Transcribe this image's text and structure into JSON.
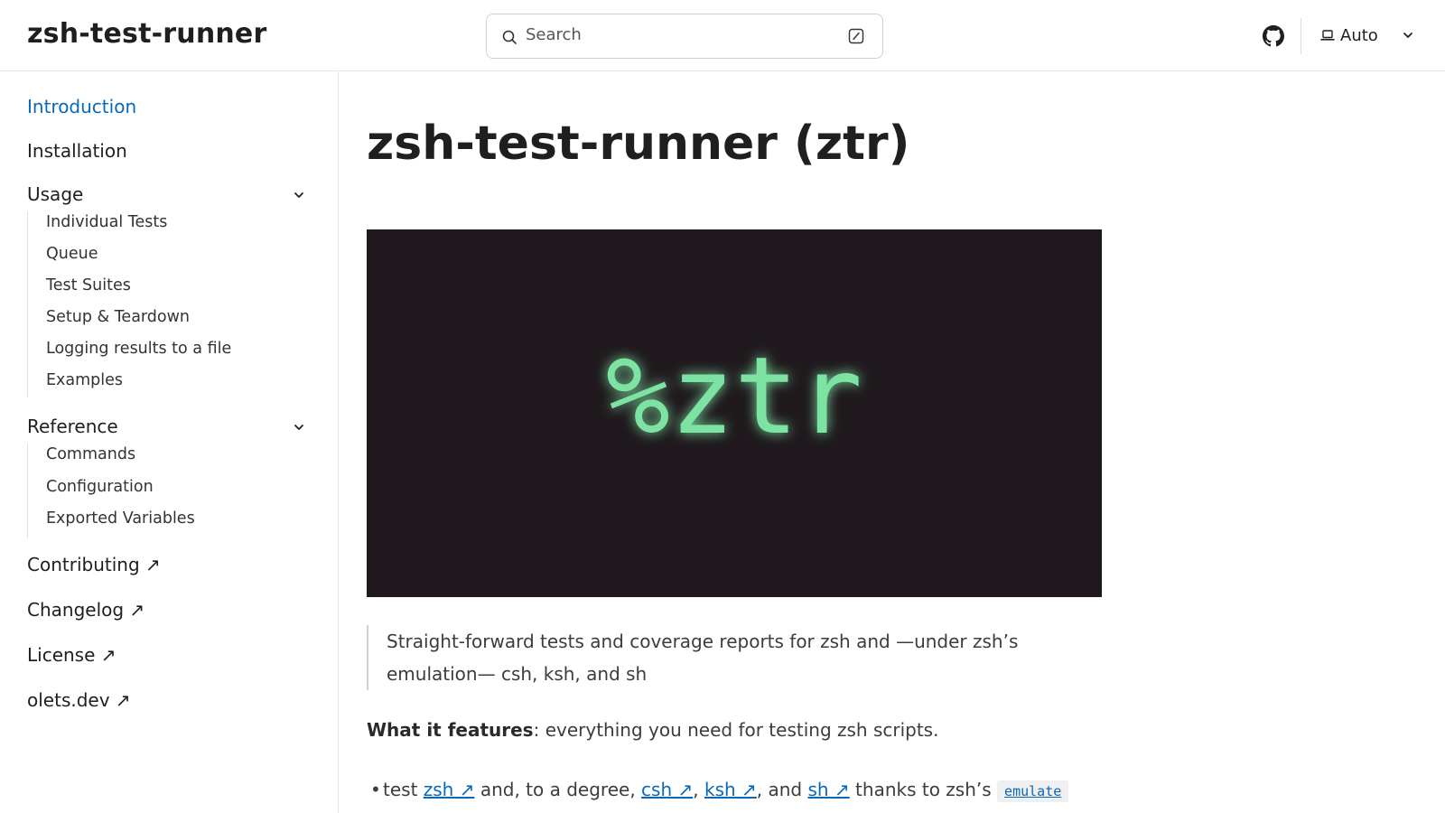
{
  "header": {
    "site_title": "zsh-test-runner",
    "search_placeholder": "Search",
    "theme_label": "Auto"
  },
  "sidebar": {
    "introduction": "Introduction",
    "installation": "Installation",
    "usage": {
      "label": "Usage",
      "items": [
        "Individual Tests",
        "Queue",
        "Test Suites",
        "Setup & Teardown",
        "Logging results to a file",
        "Examples"
      ]
    },
    "reference": {
      "label": "Reference",
      "items": [
        "Commands",
        "Configuration",
        "Exported Variables"
      ]
    },
    "contributing": "Contributing ↗",
    "changelog": "Changelog ↗",
    "license": "License ↗",
    "olets": "olets.dev ↗"
  },
  "main": {
    "title": "zsh-test-runner (ztr)",
    "hero_text": "%ztr",
    "quote_line1": "Straight-forward tests and coverage reports for zsh and —under zsh’s",
    "quote_line2": "emulation— csh, ksh, and sh",
    "features_bold": "What it features",
    "features_rest": ": everything you need for testing zsh scripts.",
    "bullet": {
      "t1": "test ",
      "zsh": "zsh ↗",
      "t2": " and, to a degree, ",
      "csh": "csh ↗",
      "t3": ", ",
      "ksh": "ksh ↗",
      "t4": ", and ",
      "sh": "sh ↗",
      "t5": " thanks to zsh’s ",
      "code": "emulate"
    }
  },
  "colors": {
    "accent": "#0969b9",
    "hero_bg": "#1f191d",
    "hero_text": "#7de3a3"
  },
  "icons": [
    "search-icon",
    "keyboard-shortcut-icon",
    "github-icon",
    "laptop-icon",
    "chevron-down-icon"
  ]
}
